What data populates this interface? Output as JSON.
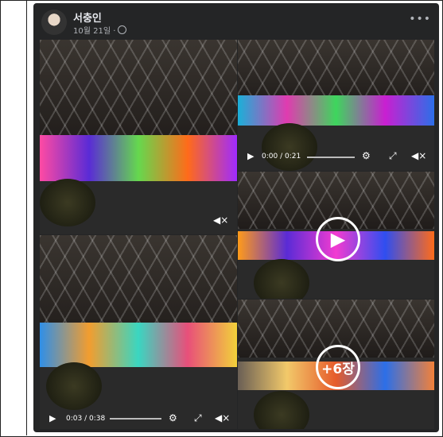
{
  "post": {
    "author": "서충인",
    "date": "10월 21일 ·",
    "more_icon": "more-icon"
  },
  "video_top_right": {
    "time": "0:00 / 0:21"
  },
  "video_bottom_left": {
    "time": "0:03 / 0:38"
  },
  "more_photos": "+6장"
}
